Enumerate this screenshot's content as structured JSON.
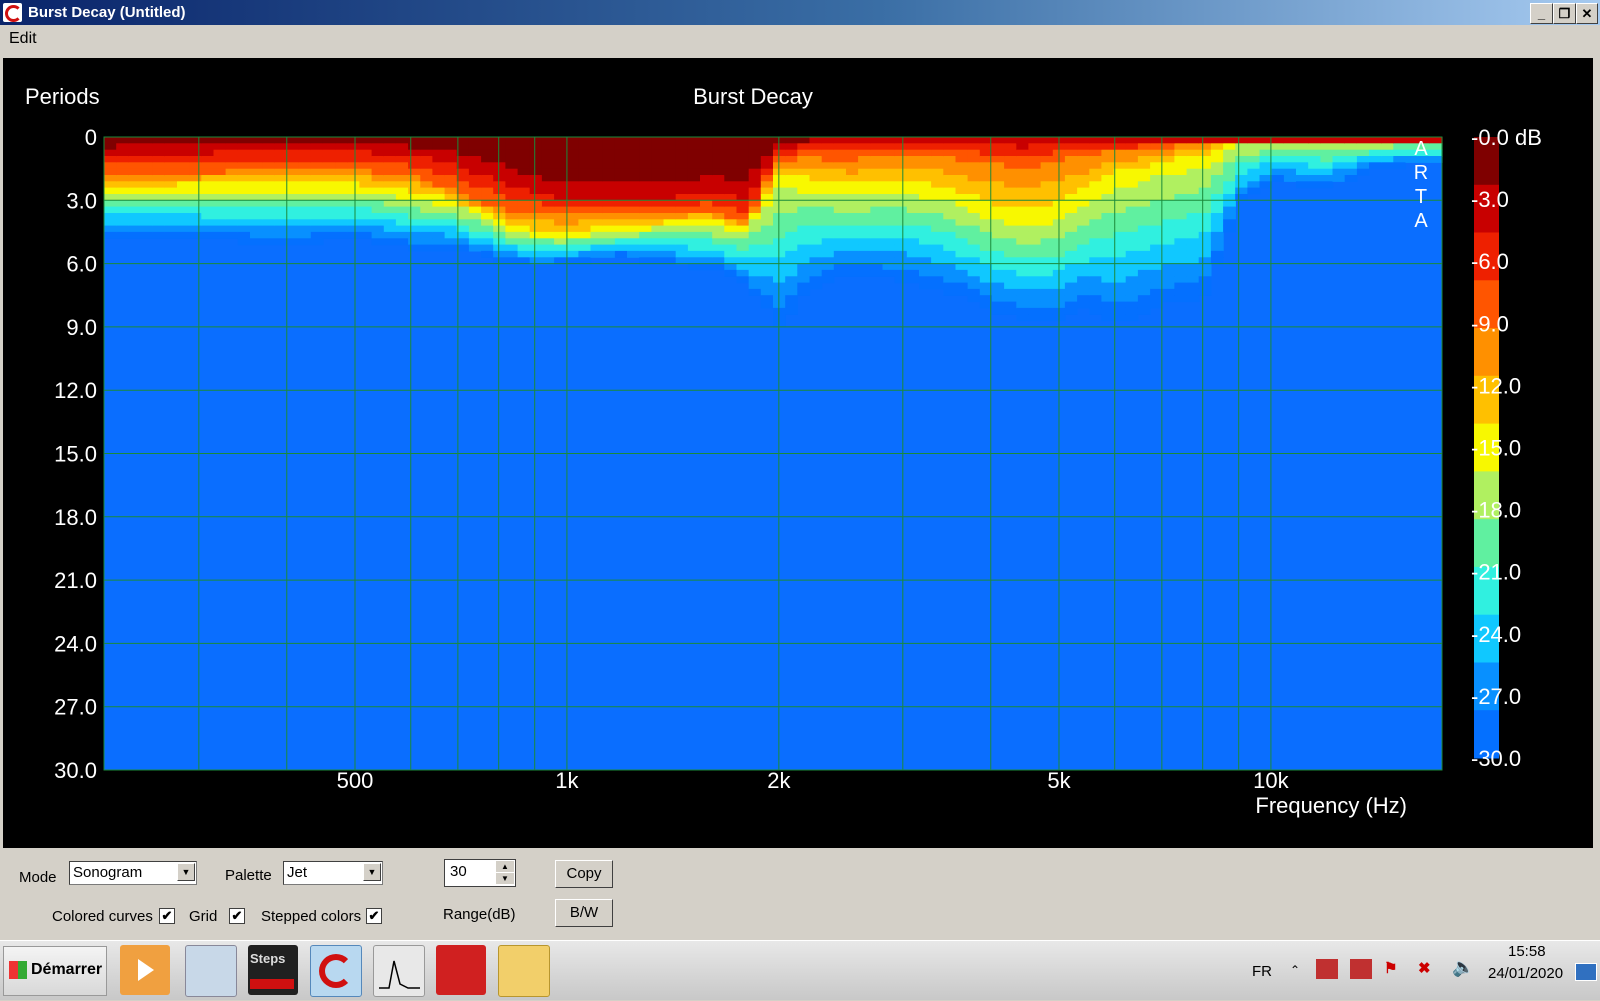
{
  "window": {
    "title": "Burst Decay  (Untitled)"
  },
  "menu": {
    "edit": "Edit"
  },
  "chart_data": {
    "type": "heatmap",
    "title": "Burst Decay",
    "ylabel": "Periods",
    "xlabel": "Frequency (Hz)",
    "watermark": "ARTA",
    "x_scale": "log",
    "xlim": [
      220,
      17500
    ],
    "x_ticks": [
      {
        "value": 500,
        "label": "500"
      },
      {
        "value": 1000,
        "label": "1k"
      },
      {
        "value": 2000,
        "label": "2k"
      },
      {
        "value": 5000,
        "label": "5k"
      },
      {
        "value": 10000,
        "label": "10k"
      }
    ],
    "x_gridlines": [
      300,
      400,
      500,
      600,
      700,
      800,
      900,
      1000,
      2000,
      3000,
      4000,
      5000,
      6000,
      7000,
      8000,
      9000,
      10000
    ],
    "ylim": [
      0,
      30
    ],
    "y_reversed": true,
    "y_ticks": [
      "0",
      "3.0",
      "6.0",
      "9.0",
      "12.0",
      "15.0",
      "18.0",
      "21.0",
      "24.0",
      "27.0",
      "30.0"
    ],
    "colorbar": {
      "unit": "dB",
      "range": [
        -30,
        0
      ],
      "labels": [
        "-0.0 dB",
        "-3.0",
        "-6.0",
        "-9.0",
        "-12.0",
        "-15.0",
        "-18.0",
        "-21.0",
        "-24.0",
        "-27.0",
        "-30.0"
      ],
      "steps": [
        "#7f0000",
        "#c80000",
        "#ee2000",
        "#ff5500",
        "#ff9000",
        "#ffc000",
        "#f8f800",
        "#b0f060",
        "#60f0a0",
        "#30f0e0",
        "#10c8ff",
        "#0890ff",
        "#0470ff"
      ],
      "background": "#0a6eff"
    },
    "decay_series": {
      "description": "Decay time in periods where the response falls below each dB threshold, per frequency (values from chart)",
      "freq": [
        220,
        300,
        400,
        500,
        600,
        700,
        800,
        900,
        1000,
        1200,
        1400,
        1600,
        1800,
        2000,
        2200,
        2500,
        3000,
        3500,
        4000,
        4500,
        5000,
        5500,
        6000,
        7000,
        8000,
        9000,
        10000,
        12000,
        14000,
        16000
      ],
      "to_minus3": [
        0.4,
        0.3,
        0.2,
        0.2,
        0.4,
        0.8,
        1.5,
        2.2,
        2.6,
        2.6,
        2.5,
        2.3,
        2.4,
        0.2,
        0.0,
        0.0,
        0.0,
        0.0,
        0.0,
        0.0,
        0.0,
        0.0,
        0.0,
        0.0,
        0.0,
        0.0,
        0.0,
        0.0,
        0.0,
        0.0
      ],
      "to_minus9": [
        1.6,
        1.5,
        1.4,
        1.4,
        1.6,
        2.4,
        3.2,
        3.4,
        3.5,
        3.5,
        3.4,
        3.3,
        3.9,
        1.0,
        0.8,
        0.9,
        0.6,
        0.8,
        1.0,
        1.2,
        0.8,
        0.6,
        0.5,
        0.4,
        0.0,
        0.0,
        0.0,
        0.0,
        0.0,
        0.0
      ],
      "to_minus15": [
        2.4,
        2.2,
        2.2,
        2.2,
        2.6,
        3.0,
        4.0,
        4.4,
        4.5,
        4.2,
        4.0,
        3.9,
        4.2,
        1.8,
        2.0,
        2.4,
        2.2,
        2.6,
        3.4,
        3.8,
        3.4,
        2.6,
        1.8,
        1.2,
        0.8,
        0.0,
        0.0,
        0.0,
        0.0,
        0.0
      ],
      "to_minus30": [
        4.6,
        4.8,
        5.0,
        4.8,
        5.2,
        5.2,
        5.8,
        6.0,
        5.9,
        5.6,
        6.0,
        6.2,
        7.0,
        9.0,
        7.4,
        6.4,
        6.8,
        7.4,
        8.2,
        8.8,
        8.6,
        8.2,
        9.0,
        8.0,
        7.8,
        3.2,
        2.0,
        2.4,
        1.4,
        1.2
      ]
    }
  },
  "controls": {
    "mode_label": "Mode",
    "mode_value": "Sonogram",
    "palette_label": "Palette",
    "palette_value": "Jet",
    "range_value": "30",
    "range_label": "Range(dB)",
    "copy_label": "Copy",
    "bw_label": "B/W",
    "colored_curves_label": "Colored curves",
    "grid_label": "Grid",
    "stepped_colors_label": "Stepped colors",
    "colored_curves_checked": true,
    "grid_checked": true,
    "stepped_colors_checked": true
  },
  "taskbar": {
    "start_label": "Démarrer",
    "steps_label": "Steps",
    "lang": "FR",
    "time": "15:58",
    "date": "24/01/2020"
  }
}
